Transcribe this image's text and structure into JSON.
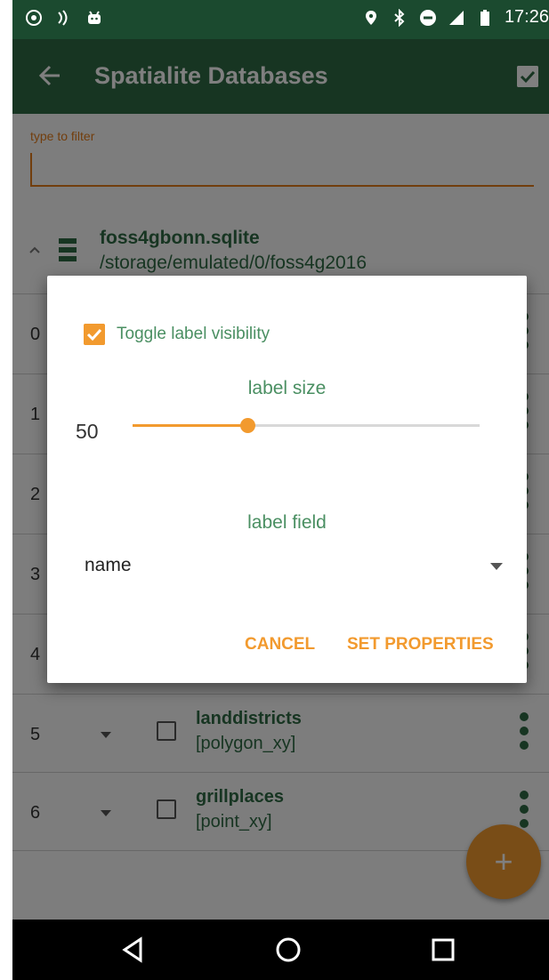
{
  "status_bar": {
    "time": "17:26",
    "icons": [
      "shield-icon",
      "nfc-icon",
      "android-icon",
      "location-icon",
      "bluetooth-icon",
      "do-not-disturb-icon",
      "signal-icon",
      "battery-icon"
    ]
  },
  "app_bar": {
    "title": "Spatialite Databases",
    "back_icon": "arrow-left-icon",
    "action_icon": "check-box-icon"
  },
  "filter": {
    "label": "type to filter",
    "value": ""
  },
  "database": {
    "name": "foss4gbonn.sqlite",
    "path": "/storage/emulated/0/foss4g2016"
  },
  "layers": [
    {
      "index": "0",
      "name": "",
      "type": ""
    },
    {
      "index": "1",
      "name": "",
      "type": ""
    },
    {
      "index": "2",
      "name": "",
      "type": ""
    },
    {
      "index": "3",
      "name": "",
      "type": ""
    },
    {
      "index": "4",
      "name": "",
      "type": ""
    },
    {
      "index": "5",
      "name": "landdistricts",
      "type": "[polygon_xy]"
    },
    {
      "index": "6",
      "name": "grillplaces",
      "type": "[point_xy]"
    }
  ],
  "dialog": {
    "toggle_label": "Toggle label visibility",
    "toggle_checked": true,
    "size_label": "label size",
    "size_value": "50",
    "size_slider_fraction": 0.33,
    "field_label": "label field",
    "field_value": "name",
    "cancel_label": "CANCEL",
    "set_label": "SET PROPERTIES"
  },
  "fab": {
    "icon": "plus-icon",
    "label": "+"
  },
  "colors": {
    "primary": "#2f6b44",
    "primary_dark": "#1b4a2f",
    "accent": "#f29a2e"
  }
}
